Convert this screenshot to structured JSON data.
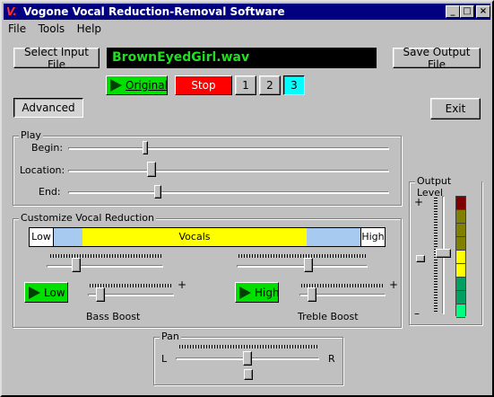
{
  "window": {
    "title": "Vogone Vocal Reduction-Removal Software",
    "icon": "vogone-logo-icon",
    "controls": [
      "minimize-icon",
      "maximize-icon",
      "close-icon"
    ]
  },
  "menu": {
    "items": [
      "File",
      "Tools",
      "Help"
    ]
  },
  "toolbar": {
    "select_input_label": "Select Input File",
    "file_name": "BrownEyedGirl.wav",
    "save_output_label": "Save Output File",
    "original_label": "Original",
    "stop_label": "Stop",
    "preset_1": "1",
    "preset_2": "2",
    "preset_3": "3",
    "advanced_label": "Advanced",
    "exit_label": "Exit"
  },
  "play": {
    "title": "Play",
    "begin_label": "Begin:",
    "location_label": "Location:",
    "end_label": "End:",
    "begin_fraction": 0.24,
    "location_fraction": 0.26,
    "end_fraction": 0.28
  },
  "vocal": {
    "title": "Customize Vocal Reduction",
    "low_label": "Low",
    "vocals_label": "Vocals",
    "high_label": "High",
    "low_cut_fraction": 0.25,
    "high_cut_fraction": 0.55,
    "low_button": "Low",
    "high_button": "High",
    "bass_label": "Bass Boost",
    "treble_label": "Treble Boost",
    "plus_sign": "+",
    "bass_fraction": 0.15,
    "treble_fraction": 0.15
  },
  "pan": {
    "title": "Pan",
    "left_label": "L",
    "right_label": "R",
    "pan_fraction": 0.5
  },
  "output": {
    "title": "Output Level",
    "plus_sign": "+",
    "minus_sign": "–",
    "level_fraction": 0.45,
    "meter_colors": [
      "#800000",
      "#808000",
      "#808000",
      "#808000",
      "#ffff00",
      "#ffff00",
      "#00a060",
      "#00a060",
      "#00ff80"
    ]
  },
  "colors": {
    "titlebar": "#000080",
    "play_green": "#00e000",
    "stop_red": "#ff0000",
    "selected_preset": "#00ffff",
    "file_text": "#22dd22"
  }
}
